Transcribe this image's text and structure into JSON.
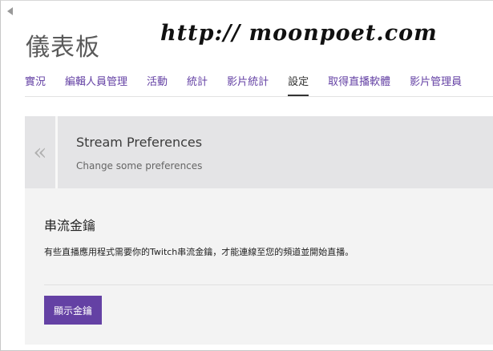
{
  "page": {
    "title": "儀表板",
    "watermark": "http:// moonpoet.com"
  },
  "nav": {
    "items": [
      {
        "label": "實況",
        "active": false
      },
      {
        "label": "編輯人員管理",
        "active": false
      },
      {
        "label": "活動",
        "active": false
      },
      {
        "label": "統計",
        "active": false
      },
      {
        "label": "影片統計",
        "active": false
      },
      {
        "label": "設定",
        "active": true
      },
      {
        "label": "取得直播軟體",
        "active": false
      },
      {
        "label": "影片管理員",
        "active": false
      }
    ]
  },
  "card": {
    "collapse_icon": "«",
    "title": "Stream Preferences",
    "subtitle": "Change some preferences"
  },
  "stream_key": {
    "title": "串流金鑰",
    "description": "有些直播應用程式需要你的Twitch串流金鑰，才能連線至您的頻道並開始直播。",
    "button_label": "顯示金鑰"
  },
  "colors": {
    "accent": "#6441a4",
    "header_bg": "#e4e4e6",
    "card_bg": "#f3f3f3"
  }
}
